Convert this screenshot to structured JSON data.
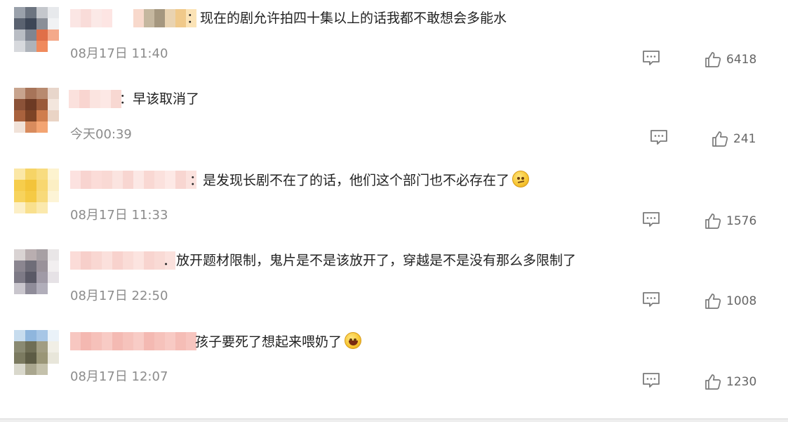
{
  "comments": [
    {
      "text": "：现在的剧允许拍四十集以上的话我都不敢想会多能水",
      "time": "08月17日 11:40",
      "likes": "6418",
      "emoji": "",
      "avatar_colors": [
        "#9aa1ab",
        "#6c7480",
        "#c4c7cc",
        "#e7e9ec",
        "#5a6270",
        "#3d4656",
        "#8a8f98",
        "#f1f2f4",
        "#b9bdc4",
        "#7f8591",
        "#e06f48",
        "#f4a98a",
        "#d7d9dd",
        "#aeb3ba",
        "#f08a5d",
        "#ffffff"
      ],
      "username_colors": [
        "#fbe6e4",
        "#f9dcd9",
        "#fbe9e7",
        "#fde5e3",
        "#ffffff",
        "#ffffff",
        "#f8d9cc",
        "#c5b79f",
        "#a5977f",
        "#e9d3b1",
        "#f0c98a",
        "#fbe3b6"
      ]
    },
    {
      "text": "：早该取消了",
      "time": "今天00:39",
      "likes": "241",
      "emoji": "",
      "avatar_colors": [
        "#c8a48e",
        "#a77459",
        "#b88a6f",
        "#e8d6cb",
        "#8b5238",
        "#6d3a24",
        "#9a5a3a",
        "#f3e6dd",
        "#a9623d",
        "#7e4426",
        "#cf7d4d",
        "#ead4c5",
        "#f1e2d8",
        "#d88b5d",
        "#f3a472",
        "#ffffff"
      ],
      "username_colors": [
        "#fbe1dd",
        "#f9d5d0",
        "#fbe4e0",
        "#fde8e5",
        "#f8d8d2"
      ]
    },
    {
      "text": "：是发现长剧不在了的话，他们这个部门也不必存在了",
      "time": "08月17日 11:33",
      "likes": "1576",
      "emoji": "think",
      "avatar_colors": [
        "#fbe7a6",
        "#f6d466",
        "#f8dc80",
        "#fdf3cf",
        "#f6cd4c",
        "#f3c43a",
        "#f8d770",
        "#fcefc4",
        "#f7d35d",
        "#f5ca44",
        "#f8da7a",
        "#fdf4d6",
        "#fcefc6",
        "#f9e08d",
        "#fbe9ad",
        "#ffffff"
      ],
      "username_colors": [
        "#fce2e0",
        "#f8d4d0",
        "#fbdcd8",
        "#f9d9d4",
        "#fbe4e0",
        "#f8d6d1",
        "#fce8e5",
        "#f9d8d3",
        "#fbe1dd",
        "#fde9e6",
        "#f8d6d1",
        "#fbe2de"
      ]
    },
    {
      "text": "．放开题材限制，鬼片是不是该放开了，穿越是不是没有那么多限制了",
      "time": "08月17日 22:50",
      "likes": "1008",
      "emoji": "",
      "avatar_colors": [
        "#d9d3d3",
        "#b9aeb0",
        "#a7a0a4",
        "#e9e6e7",
        "#8b8690",
        "#6f6d78",
        "#9a929a",
        "#f2eff0",
        "#7d7a86",
        "#5a5966",
        "#a09aa6",
        "#e6e2e6",
        "#c9c6cd",
        "#8f8c99",
        "#b1aeba",
        "#ffffff"
      ],
      "username_colors": [
        "#fbdcd8",
        "#f7cfca",
        "#f9d7d2",
        "#fbe0dc",
        "#f8d2cd",
        "#fadcd7",
        "#fce4e0",
        "#f8d4cf",
        "#f9dad5",
        "#fbe1dd"
      ]
    },
    {
      "text": "孩子要死了想起来喂奶了",
      "time": "08月17日 12:07",
      "likes": "1230",
      "emoji": "laugh",
      "avatar_colors": [
        "#c7dcee",
        "#8fb6dd",
        "#a7c6e6",
        "#eaf2f9",
        "#8a8a72",
        "#6f6e55",
        "#a19d82",
        "#f1efe6",
        "#7b7a60",
        "#5d5c45",
        "#9a9677",
        "#e8e6da",
        "#d9d8cc",
        "#a9a68e",
        "#c4c1ab",
        "#ffffff"
      ],
      "username_colors": [
        "#f7c7c1",
        "#f4b8b1",
        "#f6c1ba",
        "#f8cbc5",
        "#f4bab3",
        "#f6c3bc",
        "#f8ccc6",
        "#f4b9b2",
        "#f6c2bb",
        "#f8cac4",
        "#f5bdb6",
        "#f7c5bf"
      ]
    }
  ]
}
